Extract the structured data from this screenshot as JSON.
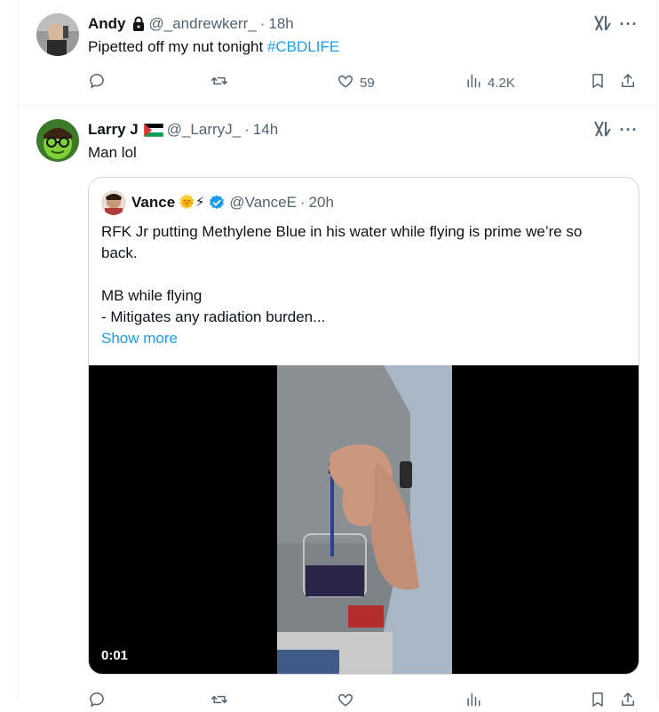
{
  "tweet1": {
    "name": "Andy",
    "handle": "@_andrewkerr_",
    "dot": "·",
    "time": "18h",
    "text": "Pipetted off my nut tonight ",
    "hashtag": "#CBDLIFE",
    "more": "···",
    "actions": {
      "replies": "",
      "reposts": "",
      "likes": "59",
      "views": "4.2K"
    }
  },
  "tweet2": {
    "name": "Larry J",
    "handle": "@_LarryJ_",
    "dot": "·",
    "time": "14h",
    "text": "Man lol",
    "more": "···",
    "quote": {
      "name": "Vance",
      "badges": "🌞⚡",
      "handle": "@VanceE",
      "dot": "·",
      "time": "20h",
      "line1": "RFK Jr putting Methylene Blue in his water while flying is prime we’re so",
      "line2": "back.",
      "line3": "MB while flying",
      "line4": "- Mitigates any radiation burden...",
      "show_more": "Show more",
      "video_time": "0:01"
    }
  },
  "colors": {
    "accent": "#1d9bf0",
    "muted": "#536471",
    "text": "#0f1419",
    "border": "#cfd9de"
  },
  "icons": [
    "lock-icon",
    "flag-icon",
    "verified-icon",
    "grok-icon",
    "more-icon",
    "reply-icon",
    "repost-icon",
    "like-icon",
    "views-icon",
    "bookmark-icon",
    "share-icon"
  ]
}
